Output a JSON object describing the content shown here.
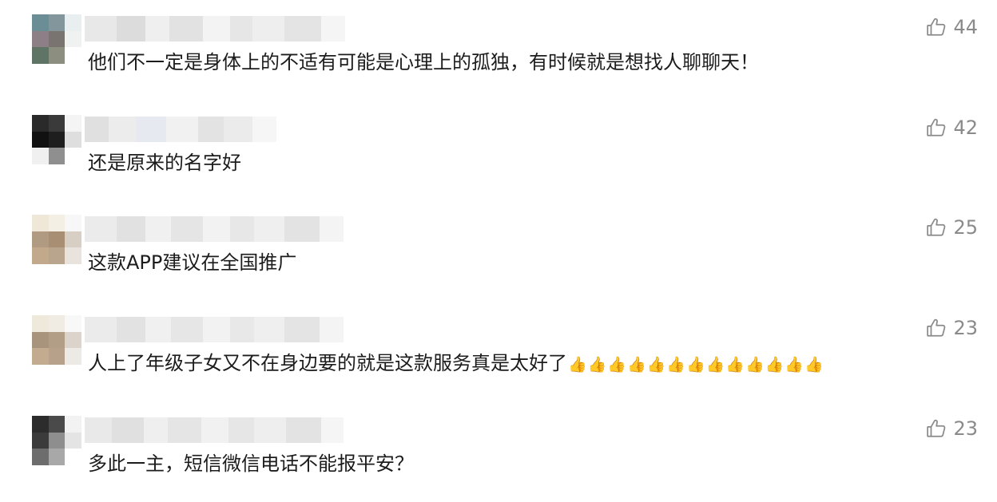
{
  "comments": [
    {
      "text": "他们不一定是身体上的不适有可能是心理上的孤独，有时候就是想找人聊聊天！",
      "likes": "44",
      "emoji_count": 0
    },
    {
      "text": "还是原来的名字好",
      "likes": "42",
      "emoji_count": 0
    },
    {
      "text": "这款APP建议在全国推广",
      "likes": "25",
      "emoji_count": 0
    },
    {
      "text": "人上了年级子女又不在身边要的就是这款服务真是太好了",
      "likes": "23",
      "emoji_count": 13,
      "emoji": "👍"
    },
    {
      "text": "多此一主，短信微信电话不能报平安？",
      "likes": "23",
      "emoji_count": 0
    }
  ],
  "icons": {
    "like": "thumbs-up-icon",
    "emoji": "thumbs-up-emoji"
  },
  "colors": {
    "like": "#8a8a8a",
    "text": "#1c1c1c",
    "username_blur": "#e6e6e6"
  }
}
